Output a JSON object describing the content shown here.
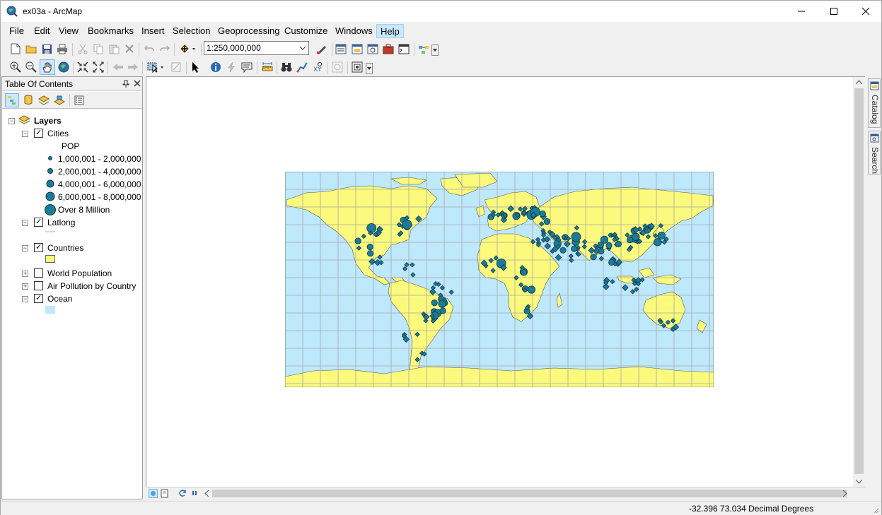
{
  "window": {
    "title": "ex03a - ArcMap"
  },
  "menu": {
    "items": [
      "File",
      "Edit",
      "View",
      "Bookmarks",
      "Insert",
      "Selection",
      "Geoprocessing",
      "Customize",
      "Windows",
      "Help"
    ],
    "active": "Help"
  },
  "toolbar": {
    "scale_value": "1:250,000,000"
  },
  "toc": {
    "title": "Table Of Contents",
    "root": "Layers",
    "layers": [
      {
        "name": "Cities",
        "checked": true,
        "expanded": true,
        "field": "POP",
        "classes": [
          "1,000,001 - 2,000,000",
          "2,000,001 - 4,000,000",
          "4,000,001 - 6,000,000",
          "6,000,001 - 8,000,000",
          "Over 8 Million"
        ]
      },
      {
        "name": "Latlong",
        "checked": true,
        "expanded": true
      },
      {
        "name": "Countries",
        "checked": true,
        "expanded": true
      },
      {
        "name": "World Population",
        "checked": false,
        "expanded": false
      },
      {
        "name": "Air Pollution by Country",
        "checked": false,
        "expanded": false
      },
      {
        "name": "Ocean",
        "checked": true,
        "expanded": true
      }
    ]
  },
  "dock": {
    "tabs": [
      "Catalog",
      "Search"
    ]
  },
  "status": {
    "coordinates": "-32.396  73.034 Decimal Degrees"
  },
  "colors": {
    "ocean": "#bee8fb",
    "land": "#fbfa7c",
    "country_border": "#555555",
    "graticule": "#a8a8a8",
    "city_fill": "#1a7c98",
    "city_stroke": "#10384a",
    "menu_active": "#cce8ff"
  },
  "icons": {
    "app": "arcmap-globe-icon",
    "minimize": "minimize-icon",
    "maximize": "maximize-icon",
    "close": "close-icon"
  }
}
